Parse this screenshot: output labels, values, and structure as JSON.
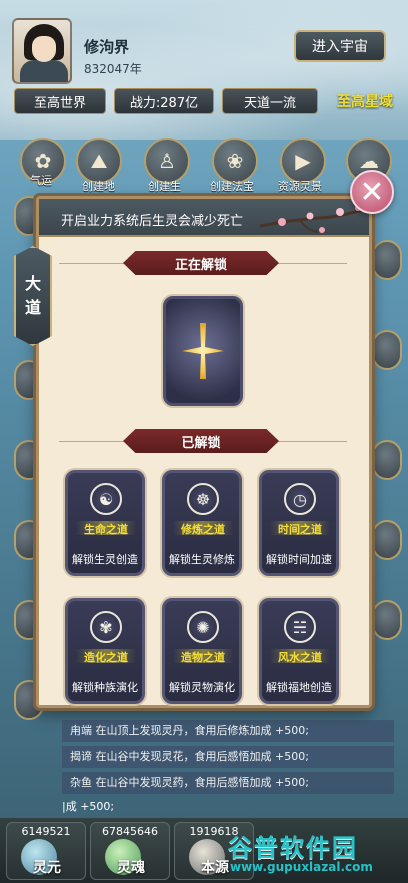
{
  "header": {
    "player_name": "修泃界",
    "player_years": "832047年",
    "enter_universe": "进入宇宙",
    "tags": {
      "world": "至高世界",
      "power": "战力:287亿",
      "dao_rank": "天道一流",
      "star_domain": "至高星域"
    }
  },
  "top_icons": [
    {
      "label": "气运",
      "icon": "flower-icon"
    },
    {
      "label": "创建地",
      "icon": "mountain-icon"
    },
    {
      "label": "创建生",
      "icon": "figure-plus-icon"
    },
    {
      "label": "创建法宝",
      "icon": "lotus-icon"
    },
    {
      "label": "资源灵景",
      "icon": "film-icon"
    },
    {
      "label": "天",
      "icon": "cloud-icon"
    }
  ],
  "modal": {
    "title": "开启业力系统后生灵会减少死亡",
    "side_tab": [
      "大",
      "道"
    ],
    "unlocking_label": "正在解锁",
    "unlocked_label": "已解锁",
    "daos": [
      {
        "name": "生命之道",
        "desc": "解锁生灵创造",
        "icon": "life-emblem-icon"
      },
      {
        "name": "修炼之道",
        "desc": "解锁生灵修炼",
        "icon": "cultivation-emblem-icon"
      },
      {
        "name": "时间之道",
        "desc": "解锁时间加速",
        "icon": "time-emblem-icon"
      },
      {
        "name": "造化之道",
        "desc": "解锁种族演化",
        "icon": "creation-emblem-icon"
      },
      {
        "name": "造物之道",
        "desc": "解锁灵物演化",
        "icon": "artifact-emblem-icon"
      },
      {
        "name": "风水之道",
        "desc": "解锁福地创造",
        "icon": "fengshui-emblem-icon"
      }
    ]
  },
  "log": [
    "甪端 在山顶上发现灵丹，食用后修炼加成 +500;",
    "揭谛 在山谷中发现灵花，食用后感悟加成 +500;",
    "杂鱼 在山谷中发现灵药，食用后感悟加成 +500;",
    "|成 +500;"
  ],
  "resources": [
    {
      "value": "6149521",
      "label": "灵元"
    },
    {
      "value": "67845646",
      "label": "灵魂"
    },
    {
      "value": "1919618",
      "label": "本源"
    }
  ],
  "watermark": {
    "text": "谷普软件园",
    "url": "www.gupuxlazal.com"
  },
  "colors": {
    "accent_gold": "#c9b27b",
    "banner_red": "#7b2a2a",
    "dao_yellow": "#f5de3a",
    "close_pink": "#b94a6a"
  }
}
